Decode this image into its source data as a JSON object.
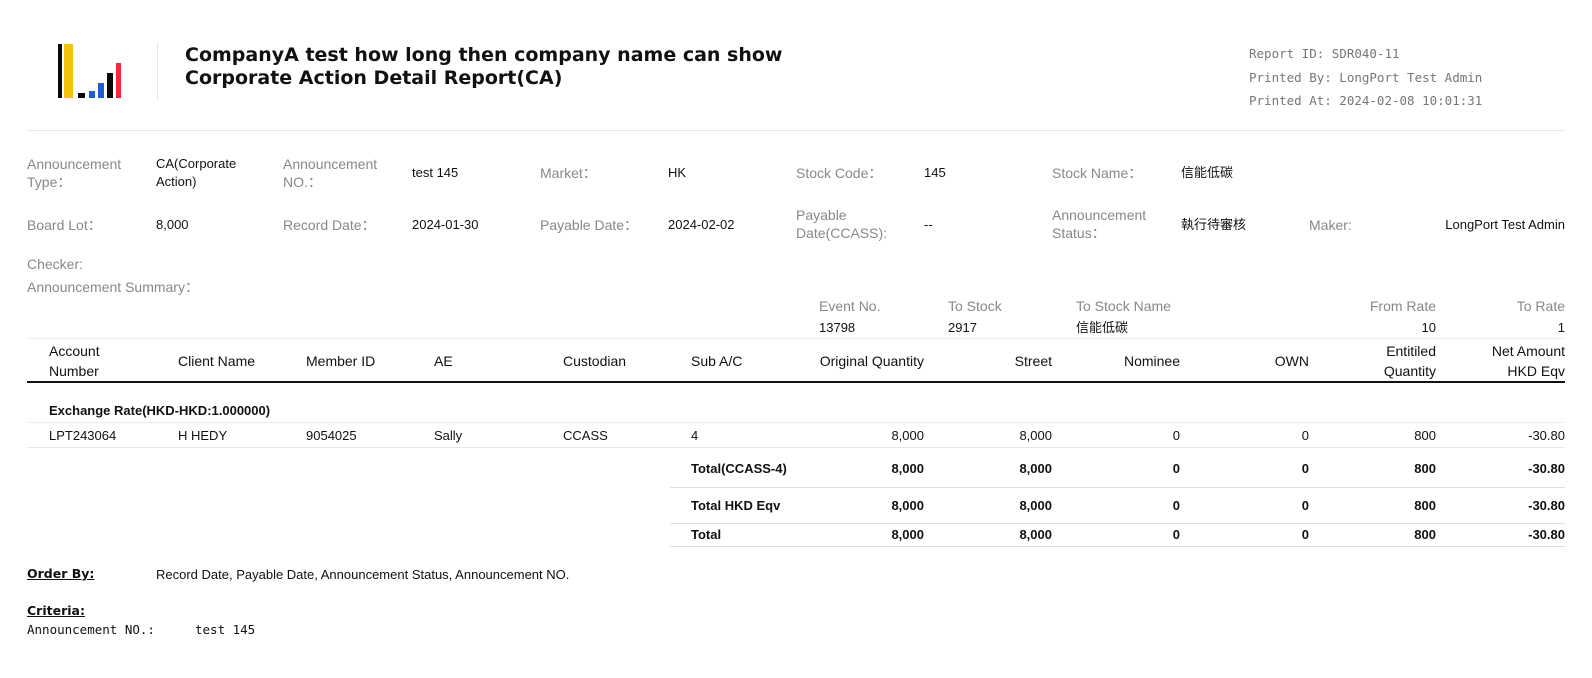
{
  "logo": {
    "icon": "bar-chart-logo",
    "colors": [
      "#0a0a0a",
      "#f4c20d",
      "#1e5bd8",
      "#ee2a3c"
    ]
  },
  "header": {
    "company_name": "CompanyA test how long then company name can show",
    "report_title": "Corporate Action Detail Report(CA)",
    "report_id": "Report  ID: SDR040-11",
    "printed_by": "Printed By: LongPort Test Admin",
    "printed_at": "Printed At: 2024-02-08 10:01:31"
  },
  "info": {
    "announcement_type_label": "Announcement Type：",
    "announcement_type_value": "CA(Corporate Action)",
    "announcement_no_label": "Announcement NO.：",
    "announcement_no_value": "test 145",
    "market_label": "Market：",
    "market_value": "HK",
    "stock_code_label": "Stock Code：",
    "stock_code_value": "145",
    "stock_name_label": "Stock Name：",
    "stock_name_value": "信能低碳",
    "board_lot_label": "Board Lot：",
    "board_lot_value": "8,000",
    "record_date_label": "Record Date：",
    "record_date_value": "2024-01-30",
    "payable_date_label": "Payable Date：",
    "payable_date_value": "2024-02-02",
    "payable_date_ccass_label": "Payable Date(CCASS):",
    "payable_date_ccass_value": "--",
    "announcement_status_label": "Announcement Status：",
    "announcement_status_value": "執行待審核",
    "maker_label": "Maker:",
    "maker_value": "LongPort Test Admin",
    "checker_label": "Checker:",
    "summary_label": "Announcement Summary："
  },
  "event": {
    "headers": [
      "Event No.",
      "To Stock",
      "To Stock Name",
      "From Rate",
      "To Rate"
    ],
    "values": [
      "13798",
      "2917",
      "信能低碳",
      "10",
      "1"
    ]
  },
  "table": {
    "headers": {
      "account_number": "Account Number",
      "client_name": "Client Name",
      "member_id": "Member ID",
      "ae": "AE",
      "custodian": "Custodian",
      "sub_ac": "Sub A/C",
      "original_quantity": "Original Quantity",
      "street": "Street",
      "nominee": "Nominee",
      "own": "OWN",
      "entitled_quantity": "Entitiled Quantity",
      "net_amount": "Net Amount HKD Eqv"
    },
    "group_label": "Exchange Rate(HKD-HKD:1.000000)",
    "row": {
      "account_number": "LPT243064",
      "client_name": "H HEDY",
      "member_id": "9054025",
      "ae": "Sally",
      "custodian": "CCASS",
      "sub_ac": "4",
      "original_quantity": "8,000",
      "street": "8,000",
      "nominee": "0",
      "own": "0",
      "entitled_quantity": "800",
      "net_amount": "-30.80"
    },
    "totals": [
      {
        "label": "Total(CCASS-4)",
        "original_quantity": "8,000",
        "street": "8,000",
        "nominee": "0",
        "own": "0",
        "entitled_quantity": "800",
        "net_amount": "-30.80"
      },
      {
        "label": "Total HKD Eqv",
        "original_quantity": "8,000",
        "street": "8,000",
        "nominee": "0",
        "own": "0",
        "entitled_quantity": "800",
        "net_amount": "-30.80"
      },
      {
        "label": "Total",
        "original_quantity": "8,000",
        "street": "8,000",
        "nominee": "0",
        "own": "0",
        "entitled_quantity": "800",
        "net_amount": "-30.80"
      }
    ]
  },
  "footer": {
    "order_by_label": "Order By:",
    "order_by_value": "Record Date, Payable Date, Announcement Status, Announcement NO.",
    "criteria_label": "Criteria:",
    "criteria_key": "Announcement NO.:",
    "criteria_value": "test 145"
  }
}
